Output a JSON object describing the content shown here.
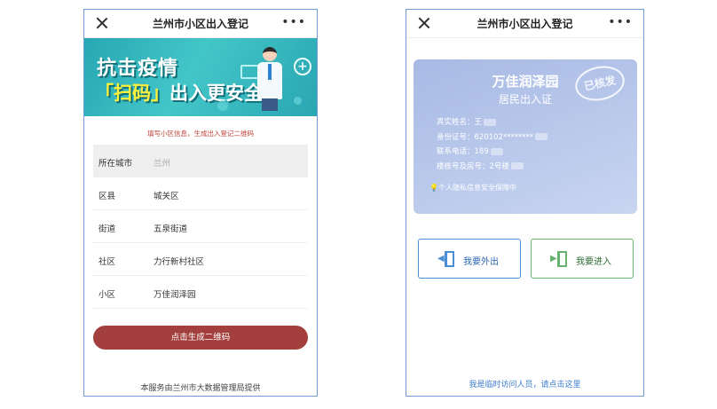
{
  "left_screen": {
    "nav": {
      "title": "兰州市小区出入登记"
    },
    "banner": {
      "line1": "抗击疫情",
      "line2_pre": "「扫码」",
      "line2_post": "出入更安全"
    },
    "hint": "填写小区信息，生成出入登记二维码",
    "form": [
      {
        "label": "所在城市",
        "value": "兰州"
      },
      {
        "label": "区县",
        "value": "城关区"
      },
      {
        "label": "街道",
        "value": "五泉街道"
      },
      {
        "label": "社区",
        "value": "力行新村社区"
      },
      {
        "label": "小区",
        "value": "万佳润泽园"
      }
    ],
    "generate_button": "点击生成二维码",
    "footer": "本服务由兰州市大数据管理局提供"
  },
  "right_screen": {
    "nav": {
      "title": "兰州市小区出入登记"
    },
    "card": {
      "community": "万佳润泽园",
      "title": "居民出入证",
      "stamp": "已核发",
      "fields": [
        {
          "label": "真实姓名：",
          "value": "王"
        },
        {
          "label": "身份证号：",
          "value": "620102********"
        },
        {
          "label": "联系电话：",
          "value": "189"
        },
        {
          "label": "楼栋号及房号：",
          "value": "2号楼"
        }
      ],
      "privacy": "个人隐私信息安全保障中"
    },
    "exit_button": "我要外出",
    "enter_button": "我要进入",
    "visitor_link": "我是临时访问人员，请点击这里"
  },
  "colors": {
    "primary_red": "#a3403e",
    "link_blue": "#3a7cd0",
    "card_blue": "#b6c6ea",
    "banner_teal": "#2aa6b3"
  }
}
